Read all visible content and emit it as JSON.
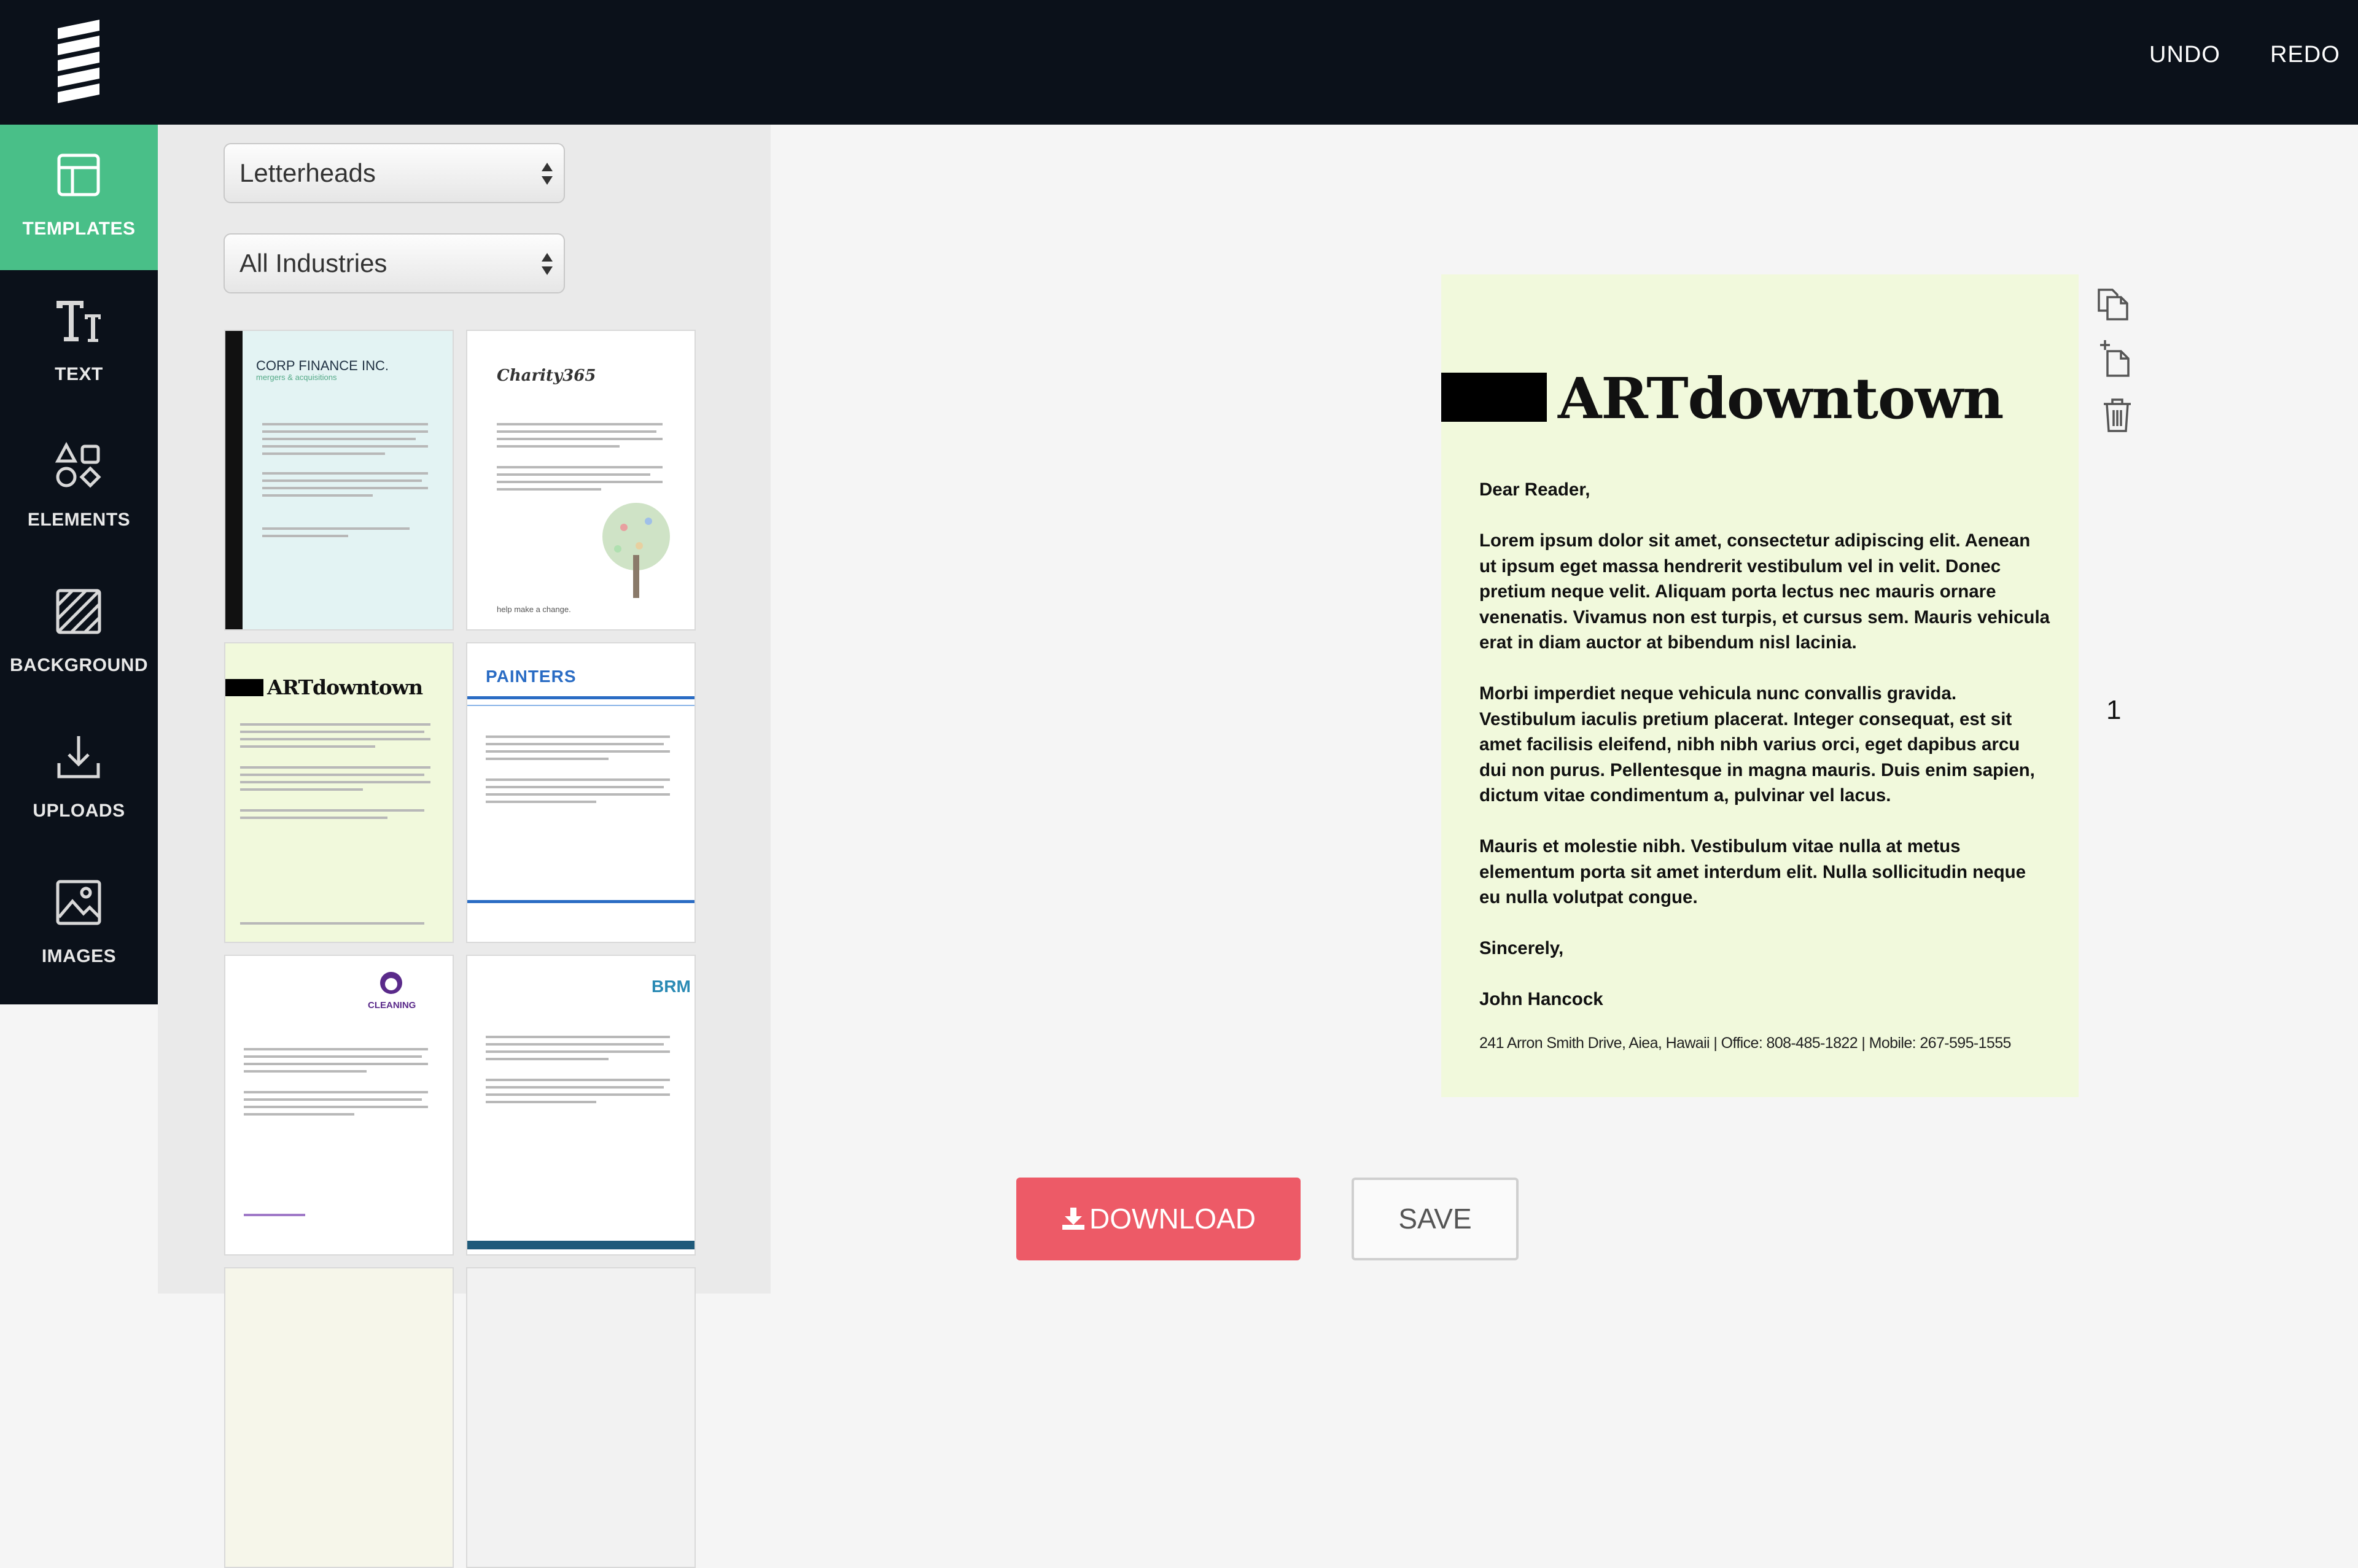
{
  "header": {
    "logo": "w-logo-icon",
    "undo_label": "UNDO",
    "redo_label": "REDO"
  },
  "sidebar": {
    "items": [
      {
        "label": "TEMPLATES",
        "icon": "layout-icon",
        "active": true
      },
      {
        "label": "TEXT",
        "icon": "text-icon"
      },
      {
        "label": "ELEMENTS",
        "icon": "shapes-icon"
      },
      {
        "label": "BACKGROUND",
        "icon": "hatch-icon"
      },
      {
        "label": "UPLOADS",
        "icon": "download-icon"
      },
      {
        "label": "IMAGES",
        "icon": "image-icon"
      }
    ],
    "active_color": "#49bf88"
  },
  "panel": {
    "category_select": "Letterheads",
    "industry_select": "All Industries",
    "templates": [
      {
        "title": "CORP FINANCE INC.",
        "subtitle": "mergers & acquisitions",
        "bg": "#e3f3f3"
      },
      {
        "title": "Charity365",
        "tagline": "help make a change.",
        "bg": "#ffffff"
      },
      {
        "title": "ARTdowntown",
        "bg": "#f1f9dc"
      },
      {
        "title": "PAINTERS",
        "bg": "#ffffff"
      },
      {
        "title": "CLEANING",
        "bg": "#ffffff"
      },
      {
        "title": "BRM",
        "bg": "#ffffff"
      }
    ]
  },
  "document": {
    "title": "ARTdowntown",
    "salutation": "Dear Reader,",
    "paragraphs": [
      "Lorem ipsum dolor sit amet, consectetur adipiscing elit. Aenean ut ipsum eget massa hendrerit vestibulum vel in velit. Donec pretium neque velit. Aliquam porta lectus nec mauris ornare venenatis. Vivamus non est turpis, et cursus sem. Mauris vehicula erat in diam auctor at bibendum nisl lacinia.",
      "Morbi imperdiet neque vehicula nunc convallis gravida. Vestibulum iaculis pretium placerat. Integer consequat, est sit amet facilisis eleifend, nibh nibh varius orci, eget dapibus arcu dui non purus. Pellentesque in magna mauris. Duis enim sapien, dictum vitae condimentum a, pulvinar vel lacus.",
      "Mauris et molestie nibh. Vestibulum vitae nulla at metus elementum porta sit amet interdum elit. Nulla sollicitudin neque eu nulla volutpat congue."
    ],
    "closing": "Sincerely,",
    "signature": "John Hancock",
    "footer": "241 Arron Smith Drive, Aiea, Hawaii  |  Office: 808-485-1822  |  Mobile: 267-595-1555",
    "page_bg": "#f1f9dc",
    "page_number": "1"
  },
  "page_tools": [
    "duplicate-page-icon",
    "add-page-icon",
    "trash-icon"
  ],
  "actions": {
    "download_label": "DOWNLOAD",
    "save_label": "SAVE",
    "download_color": "#ed5a67"
  }
}
